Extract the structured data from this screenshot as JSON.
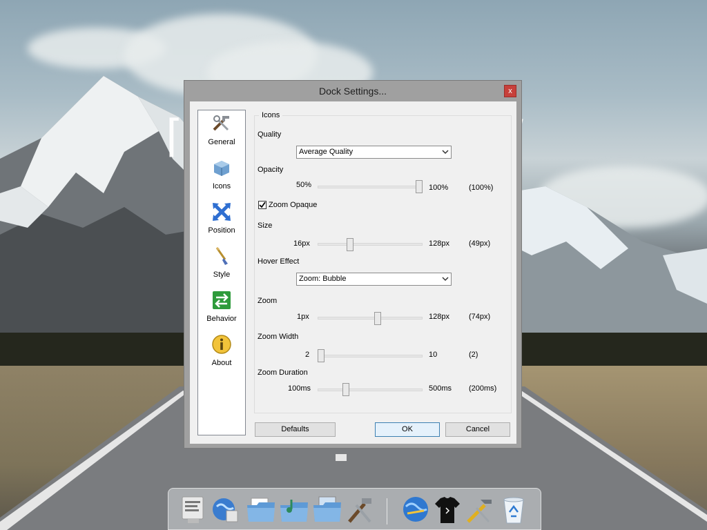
{
  "window": {
    "title": "Dock Settings...",
    "close_glyph": "x"
  },
  "sidebar": {
    "items": [
      {
        "label": "General",
        "icon": "tools-icon"
      },
      {
        "label": "Icons",
        "icon": "icons-box-icon"
      },
      {
        "label": "Position",
        "icon": "position-arrows-icon"
      },
      {
        "label": "Style",
        "icon": "paintbrush-icon"
      },
      {
        "label": "Behavior",
        "icon": "behavior-arrows-icon"
      },
      {
        "label": "About",
        "icon": "info-icon"
      }
    ]
  },
  "panel": {
    "group_title": "Icons",
    "quality": {
      "label": "Quality",
      "value": "Average Quality"
    },
    "opacity": {
      "label": "Opacity",
      "min": "50%",
      "max": "100%",
      "current": "(100%)",
      "level": 1.0
    },
    "zoom_opaque": {
      "label": "Zoom Opaque",
      "checked": true
    },
    "size": {
      "label": "Size",
      "min": "16px",
      "max": "128px",
      "current": "(49px)",
      "level": 0.295
    },
    "hover_effect": {
      "label": "Hover Effect",
      "value": "Zoom: Bubble"
    },
    "zoom": {
      "label": "Zoom",
      "min": "1px",
      "max": "128px",
      "current": "(74px)",
      "level": 0.575
    },
    "zoom_width": {
      "label": "Zoom Width",
      "min": "2",
      "max": "10",
      "current": "(2)",
      "level": 0.0
    },
    "zoom_duration": {
      "label": "Zoom Duration",
      "min": "100ms",
      "max": "500ms",
      "current": "(200ms)",
      "level": 0.25
    }
  },
  "buttons": {
    "defaults": "Defaults",
    "ok": "OK",
    "cancel": "Cancel"
  },
  "dock": {
    "items": [
      "system-monitor-icon",
      "network-globe-icon",
      "documents-folder-icon",
      "music-folder-icon",
      "pictures-folder-icon",
      "settings-tools-icon",
      "internet-globe-icon",
      "tshirt-icon",
      "hammer-tools-icon",
      "recycle-bin-icon"
    ]
  },
  "colors": {
    "close_button": "#c7403a",
    "window_frame": "#a0a0a0",
    "dialog_bg": "#f0f0f0",
    "default_button_border": "#3c7fb1"
  }
}
